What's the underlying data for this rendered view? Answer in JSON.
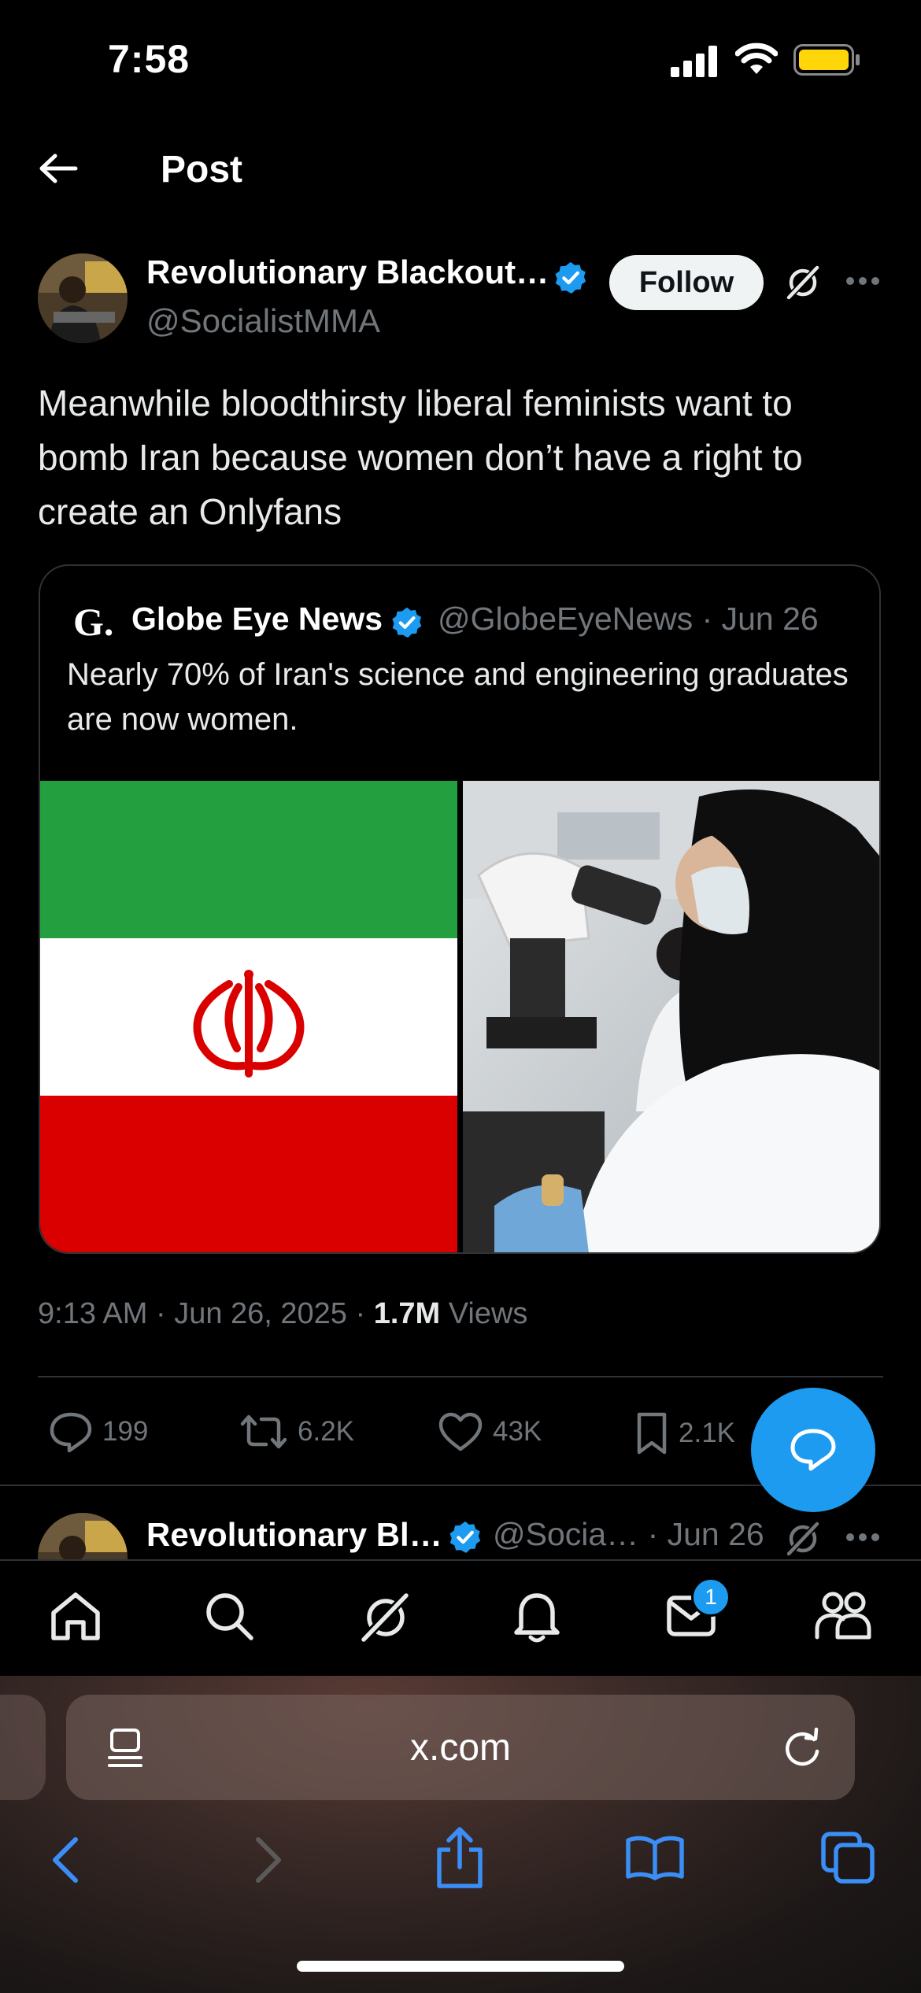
{
  "status_bar": {
    "time": "7:58"
  },
  "header": {
    "title": "Post"
  },
  "post": {
    "author_name": "Revolutionary Blackout…",
    "author_handle": "@SocialistMMA",
    "follow_label": "Follow",
    "text": "Meanwhile bloodthirsty liberal feminists want to bomb Iran because women don’t have a right to create an Onlyfans",
    "quote": {
      "logo": "G.",
      "name": "Globe Eye News",
      "handle": "@GlobeEyeNews · Jun 26",
      "text": "Nearly 70% of Iran's science and engineering graduates are now women."
    },
    "timestamp": "9:13 AM · Jun 26, 2025 · ",
    "views_count": "1.7M",
    "views_label": " Views",
    "actions": {
      "replies": "199",
      "reposts": "6.2K",
      "likes": "43K",
      "bookmarks": "2.1K"
    }
  },
  "reply_preview": {
    "author_name": "Revolutionary Bl…",
    "handle_date": "@Socia… · Jun 26"
  },
  "tab_bar": {
    "items": [
      "home-icon",
      "search-icon",
      "grok-icon",
      "notifications-icon",
      "messages-icon",
      "communities-icon"
    ],
    "messages_badge": "1"
  },
  "browser": {
    "url": "x.com",
    "toolbar": [
      "back-icon",
      "forward-icon",
      "share-icon",
      "bookmarks-icon",
      "tabs-icon"
    ]
  },
  "colors": {
    "accent": "#1d9bf0",
    "muted": "#71767b",
    "background": "#000000"
  }
}
